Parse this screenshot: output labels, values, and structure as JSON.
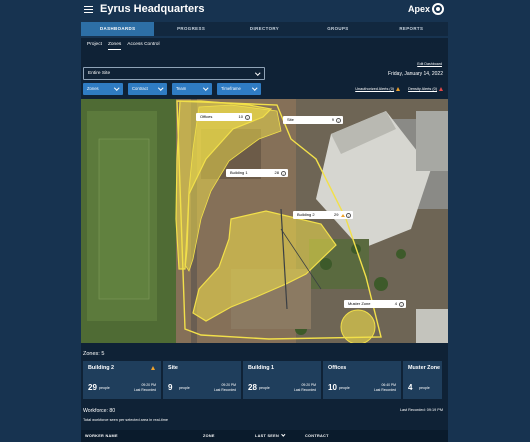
{
  "app": {
    "title": "Eyrus Headquarters",
    "logo_text": "Apex"
  },
  "nav": {
    "tabs": [
      {
        "label": "DASHBOARDS"
      },
      {
        "label": "PROGRESS"
      },
      {
        "label": "DIRECTORY"
      },
      {
        "label": "GROUPS"
      },
      {
        "label": "REPORTS"
      }
    ],
    "active": "DASHBOARDS"
  },
  "subnav": {
    "tabs": [
      {
        "label": "Project"
      },
      {
        "label": "Zones"
      },
      {
        "label": "Access Control"
      }
    ],
    "active": "Zones"
  },
  "toolbar": {
    "edit_dashboard": "Edit Dashboard",
    "site_select": "Entire Site",
    "date": "Friday, January 14, 2022",
    "filters": [
      {
        "label": "Zones"
      },
      {
        "label": "Contract"
      },
      {
        "label": "Team"
      },
      {
        "label": "Timeframe"
      }
    ],
    "alerts": [
      {
        "label": "Unauthorized Alerts (0)",
        "color": "#f0a32b"
      },
      {
        "label": "Density Alerts (0)",
        "color": "#e04848"
      }
    ]
  },
  "map": {
    "zone_color": "#f2e04a",
    "tags": [
      {
        "name": "Offices",
        "count": "10",
        "warn": false
      },
      {
        "name": "Site",
        "count": "9",
        "warn": false
      },
      {
        "name": "Building 1",
        "count": "28",
        "warn": false
      },
      {
        "name": "Building 2",
        "count": "29",
        "warn": true
      },
      {
        "name": "Muster Zone",
        "count": "4",
        "warn": false
      }
    ]
  },
  "zones": {
    "title": "Zones: 5",
    "cards": [
      {
        "name": "Building 2",
        "count": "29",
        "unit": "people",
        "time": "09:20 PM",
        "sub": "Last Recorded",
        "warn": true
      },
      {
        "name": "Site",
        "count": "9",
        "unit": "people",
        "time": "09:20 PM",
        "sub": "Last Recorded",
        "warn": false
      },
      {
        "name": "Building 1",
        "count": "28",
        "unit": "people",
        "time": "09:20 PM",
        "sub": "Last Recorded",
        "warn": false
      },
      {
        "name": "Offices",
        "count": "10",
        "unit": "people",
        "time": "06:40 PM",
        "sub": "Last Recorded",
        "warn": false
      },
      {
        "name": "Muster Zone",
        "count": "4",
        "unit": "people",
        "time": "",
        "sub": "",
        "warn": false
      }
    ]
  },
  "workforce": {
    "title": "Workforce: 80",
    "subtitle": "Total workforce seen per selected area in real-time",
    "last_recorded": "Last Recorded: 09:19 PM",
    "columns": [
      "WORKER NAME",
      "ZONE",
      "LAST SEEN",
      "CONTRACT"
    ]
  }
}
